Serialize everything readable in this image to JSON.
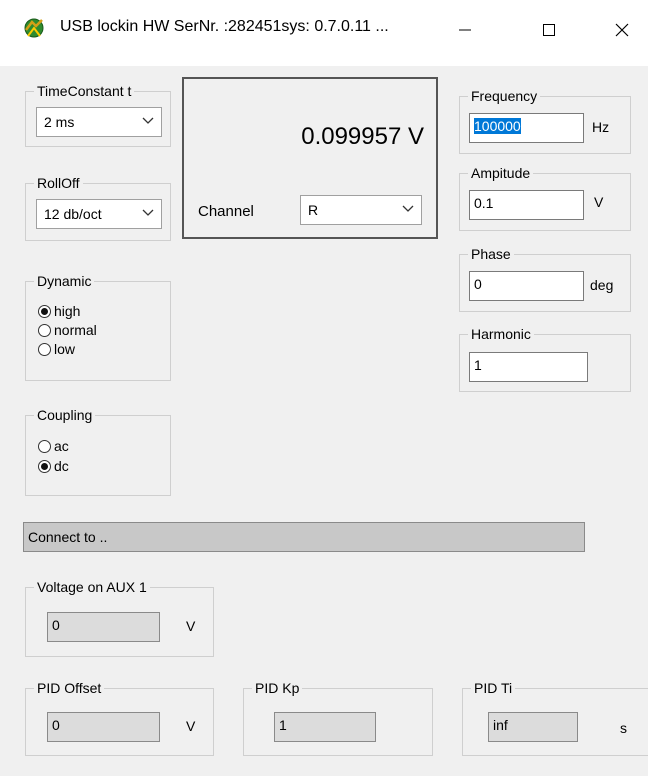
{
  "window": {
    "title": "USB lockin HW SerNr. :282451sys: 0.7.0.11 ...",
    "minimize_glyph": "—",
    "maximize_glyph": "☐",
    "close_glyph": "✕"
  },
  "time_constant": {
    "label": "TimeConstant t",
    "value": "2 ms"
  },
  "rolloff": {
    "label": "RollOff",
    "value": "12 db/oct"
  },
  "display": {
    "reading": "0.099957 V",
    "channel_label": "Channel",
    "channel_value": "R"
  },
  "dynamic": {
    "label": "Dynamic",
    "options": [
      {
        "label": "high",
        "selected": true
      },
      {
        "label": "normal",
        "selected": false
      },
      {
        "label": "low",
        "selected": false
      }
    ]
  },
  "coupling": {
    "label": "Coupling",
    "options": [
      {
        "label": "ac",
        "selected": false
      },
      {
        "label": "dc",
        "selected": true
      }
    ]
  },
  "frequency": {
    "label": "Frequency",
    "value": "100000",
    "unit": "Hz"
  },
  "amplitude": {
    "label": "Ampitude",
    "value": "0.1",
    "unit": "V"
  },
  "phase": {
    "label": "Phase",
    "value": "0",
    "unit": "deg"
  },
  "harmonic": {
    "label": "Harmonic",
    "value": "1"
  },
  "status": {
    "text": "Connect to .."
  },
  "aux": {
    "label": "Voltage on AUX 1",
    "value": "0",
    "unit": "V"
  },
  "pid_offset": {
    "label": "PID Offset",
    "value": "0",
    "unit": "V"
  },
  "pid_kp": {
    "label": "PID Kp",
    "value": "1"
  },
  "pid_ti": {
    "label": "PID Ti",
    "value": "inf",
    "unit": "s"
  },
  "colors": {
    "selection": "#0078d7",
    "status_bar": "#c8c8c8",
    "panel": "#f0f0f0"
  },
  "icons": {
    "app": "lockin-app-icon",
    "dropdown": "chevron-down-icon"
  }
}
